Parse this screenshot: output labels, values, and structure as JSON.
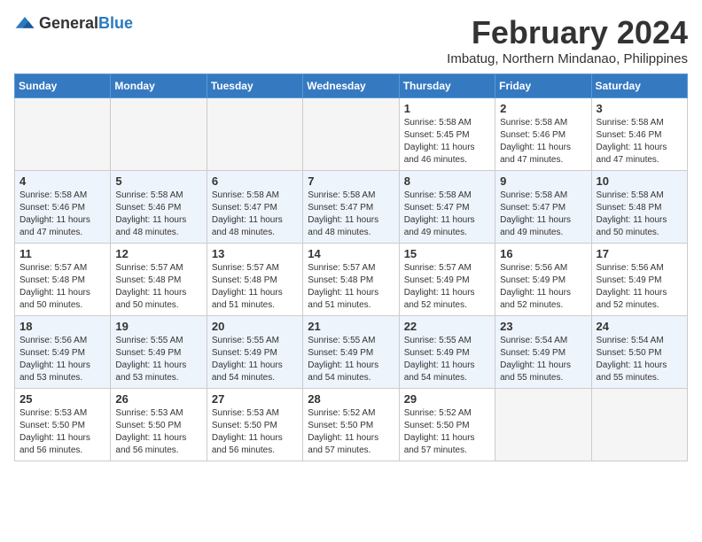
{
  "logo": {
    "general": "General",
    "blue": "Blue"
  },
  "title": {
    "month_year": "February 2024",
    "location": "Imbatug, Northern Mindanao, Philippines"
  },
  "days_of_week": [
    "Sunday",
    "Monday",
    "Tuesday",
    "Wednesday",
    "Thursday",
    "Friday",
    "Saturday"
  ],
  "weeks": [
    [
      {
        "day": "",
        "info": ""
      },
      {
        "day": "",
        "info": ""
      },
      {
        "day": "",
        "info": ""
      },
      {
        "day": "",
        "info": ""
      },
      {
        "day": "1",
        "info": "Sunrise: 5:58 AM\nSunset: 5:45 PM\nDaylight: 11 hours and 46 minutes."
      },
      {
        "day": "2",
        "info": "Sunrise: 5:58 AM\nSunset: 5:46 PM\nDaylight: 11 hours and 47 minutes."
      },
      {
        "day": "3",
        "info": "Sunrise: 5:58 AM\nSunset: 5:46 PM\nDaylight: 11 hours and 47 minutes."
      }
    ],
    [
      {
        "day": "4",
        "info": "Sunrise: 5:58 AM\nSunset: 5:46 PM\nDaylight: 11 hours and 47 minutes."
      },
      {
        "day": "5",
        "info": "Sunrise: 5:58 AM\nSunset: 5:46 PM\nDaylight: 11 hours and 48 minutes."
      },
      {
        "day": "6",
        "info": "Sunrise: 5:58 AM\nSunset: 5:47 PM\nDaylight: 11 hours and 48 minutes."
      },
      {
        "day": "7",
        "info": "Sunrise: 5:58 AM\nSunset: 5:47 PM\nDaylight: 11 hours and 48 minutes."
      },
      {
        "day": "8",
        "info": "Sunrise: 5:58 AM\nSunset: 5:47 PM\nDaylight: 11 hours and 49 minutes."
      },
      {
        "day": "9",
        "info": "Sunrise: 5:58 AM\nSunset: 5:47 PM\nDaylight: 11 hours and 49 minutes."
      },
      {
        "day": "10",
        "info": "Sunrise: 5:58 AM\nSunset: 5:48 PM\nDaylight: 11 hours and 50 minutes."
      }
    ],
    [
      {
        "day": "11",
        "info": "Sunrise: 5:57 AM\nSunset: 5:48 PM\nDaylight: 11 hours and 50 minutes."
      },
      {
        "day": "12",
        "info": "Sunrise: 5:57 AM\nSunset: 5:48 PM\nDaylight: 11 hours and 50 minutes."
      },
      {
        "day": "13",
        "info": "Sunrise: 5:57 AM\nSunset: 5:48 PM\nDaylight: 11 hours and 51 minutes."
      },
      {
        "day": "14",
        "info": "Sunrise: 5:57 AM\nSunset: 5:48 PM\nDaylight: 11 hours and 51 minutes."
      },
      {
        "day": "15",
        "info": "Sunrise: 5:57 AM\nSunset: 5:49 PM\nDaylight: 11 hours and 52 minutes."
      },
      {
        "day": "16",
        "info": "Sunrise: 5:56 AM\nSunset: 5:49 PM\nDaylight: 11 hours and 52 minutes."
      },
      {
        "day": "17",
        "info": "Sunrise: 5:56 AM\nSunset: 5:49 PM\nDaylight: 11 hours and 52 minutes."
      }
    ],
    [
      {
        "day": "18",
        "info": "Sunrise: 5:56 AM\nSunset: 5:49 PM\nDaylight: 11 hours and 53 minutes."
      },
      {
        "day": "19",
        "info": "Sunrise: 5:55 AM\nSunset: 5:49 PM\nDaylight: 11 hours and 53 minutes."
      },
      {
        "day": "20",
        "info": "Sunrise: 5:55 AM\nSunset: 5:49 PM\nDaylight: 11 hours and 54 minutes."
      },
      {
        "day": "21",
        "info": "Sunrise: 5:55 AM\nSunset: 5:49 PM\nDaylight: 11 hours and 54 minutes."
      },
      {
        "day": "22",
        "info": "Sunrise: 5:55 AM\nSunset: 5:49 PM\nDaylight: 11 hours and 54 minutes."
      },
      {
        "day": "23",
        "info": "Sunrise: 5:54 AM\nSunset: 5:49 PM\nDaylight: 11 hours and 55 minutes."
      },
      {
        "day": "24",
        "info": "Sunrise: 5:54 AM\nSunset: 5:50 PM\nDaylight: 11 hours and 55 minutes."
      }
    ],
    [
      {
        "day": "25",
        "info": "Sunrise: 5:53 AM\nSunset: 5:50 PM\nDaylight: 11 hours and 56 minutes."
      },
      {
        "day": "26",
        "info": "Sunrise: 5:53 AM\nSunset: 5:50 PM\nDaylight: 11 hours and 56 minutes."
      },
      {
        "day": "27",
        "info": "Sunrise: 5:53 AM\nSunset: 5:50 PM\nDaylight: 11 hours and 56 minutes."
      },
      {
        "day": "28",
        "info": "Sunrise: 5:52 AM\nSunset: 5:50 PM\nDaylight: 11 hours and 57 minutes."
      },
      {
        "day": "29",
        "info": "Sunrise: 5:52 AM\nSunset: 5:50 PM\nDaylight: 11 hours and 57 minutes."
      },
      {
        "day": "",
        "info": ""
      },
      {
        "day": "",
        "info": ""
      }
    ]
  ]
}
